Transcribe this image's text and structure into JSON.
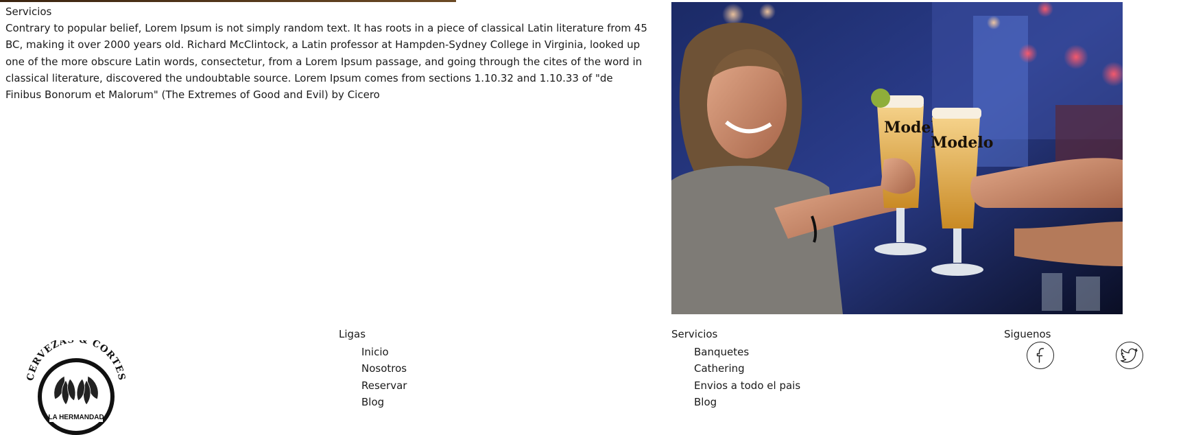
{
  "section": {
    "title": "Servicios",
    "text": "Contrary to popular belief, Lorem Ipsum is not simply random text. It has roots in a piece of classical Latin literature from 45 BC, making it over 2000 years old. Richard McClintock, a Latin professor at Hampden-Sydney College in Virginia, looked up one of the more obscure Latin words, consectetur, from a Lorem Ipsum passage, and going through the cites of the word in classical literature, discovered the undoubtable source. Lorem Ipsum comes from sections 1.10.32 and 1.10.33 of \"de Finibus Bonorum et Malorum\" (The Extremes of Good and Evil) by Cicero"
  },
  "photo": {
    "glass_brand": "Modelo"
  },
  "logo": {
    "arc_text": "CERVEZAS & CORTES",
    "banner_text": "LA HERMANDAD"
  },
  "footer": {
    "ligas": {
      "title": "Ligas",
      "links": [
        "Inicio",
        "Nosotros",
        "Reservar",
        "Blog"
      ]
    },
    "servicios": {
      "title": "Servicios",
      "links": [
        "Banquetes",
        "Cathering",
        "Envios a todo el pais",
        "Blog"
      ]
    },
    "siguenos": {
      "title": "Siguenos",
      "icons": [
        "facebook-icon",
        "twitter-icon"
      ]
    }
  }
}
